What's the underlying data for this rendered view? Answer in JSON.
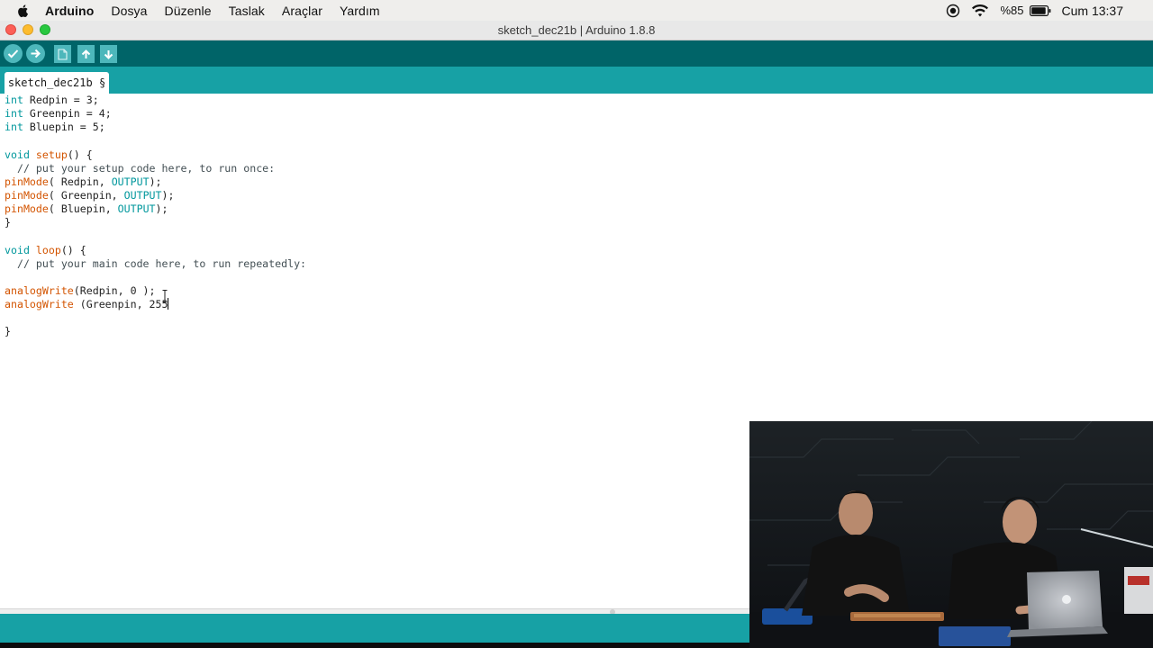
{
  "menubar": {
    "app_name": "Arduino",
    "items": [
      "Dosya",
      "Düzenle",
      "Taslak",
      "Araçlar",
      "Yardım"
    ],
    "battery_text": "%85",
    "clock": "Cum 13:37"
  },
  "window": {
    "title": "sketch_dec21b | Arduino 1.8.8"
  },
  "toolbar": {
    "buttons": [
      "verify-icon",
      "upload-icon",
      "new-icon",
      "open-icon",
      "save-icon"
    ]
  },
  "tabs": [
    {
      "label": "sketch_dec21b §"
    }
  ],
  "editor": {
    "lines": [
      "int Redpin = 3;",
      "int Greenpin = 4;",
      "int Bluepin = 5;",
      "",
      "void setup() {",
      "  // put your setup code here, to run once:",
      "pinMode( Redpin, OUTPUT);",
      "pinMode( Greenpin, OUTPUT);",
      "pinMode( Bluepin, OUTPUT);",
      "}",
      "",
      "void loop() {",
      "  // put your main code here, to run repeatedly:",
      "",
      "analogWrite(Redpin, 0 );",
      "analogWrite (Greenpin, 255",
      "",
      "}"
    ]
  },
  "colors": {
    "toolbar_bg": "#006468",
    "tabbar_bg": "#17a1a5",
    "keyword": "#00979c",
    "function": "#d35400"
  }
}
